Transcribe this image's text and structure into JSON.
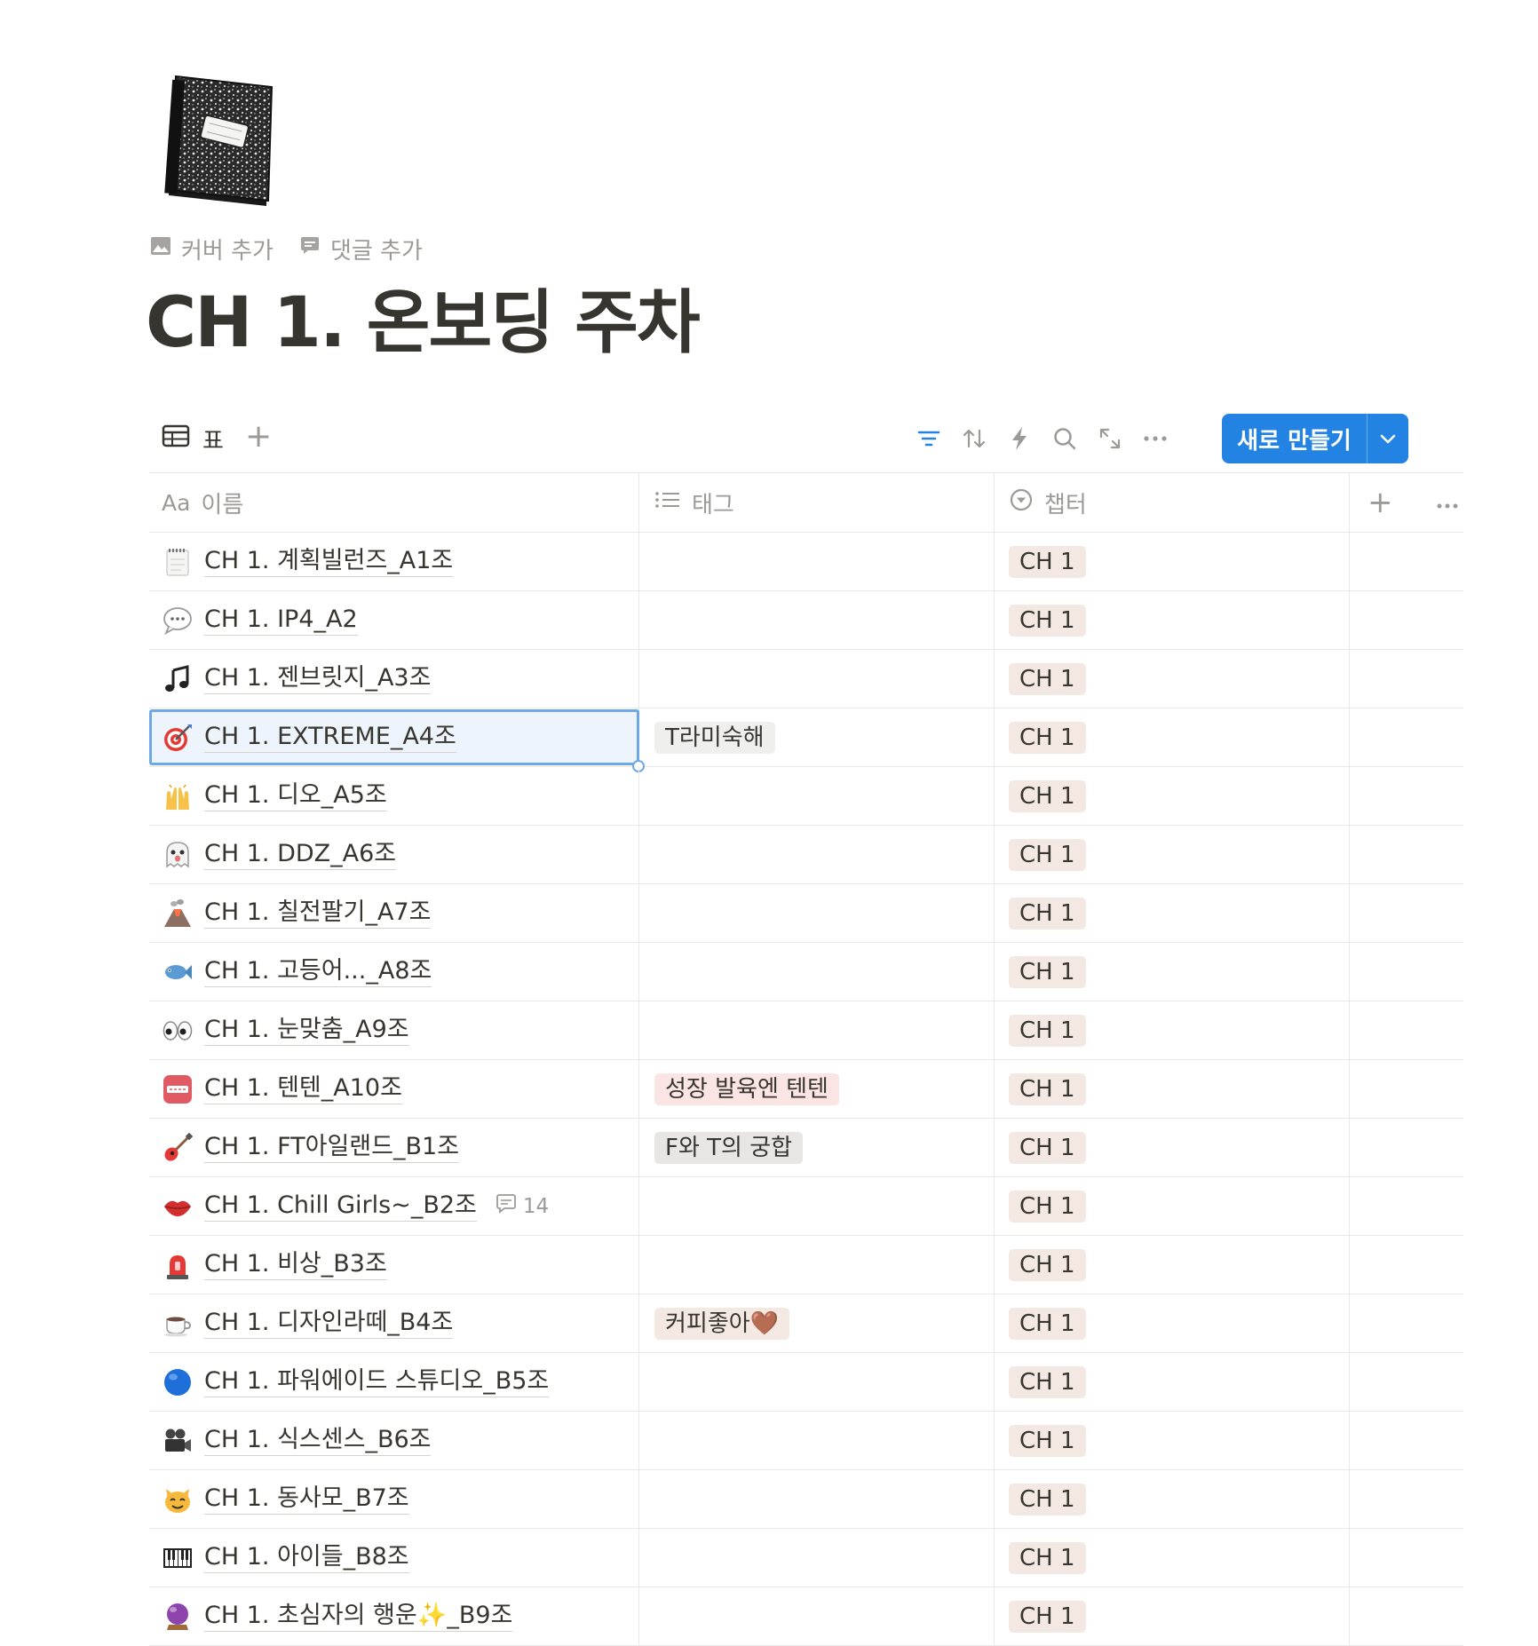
{
  "page": {
    "icon": "notebook-icon",
    "actions": {
      "cover_label": "커버 추가",
      "comment_label": "댓글 추가"
    },
    "title": "CH 1. 온보딩 주차"
  },
  "toolbar": {
    "view_label": "표",
    "new_label": "새로 만들기",
    "tools": [
      "filter-icon",
      "sort-icon",
      "automation-icon",
      "search-icon",
      "expand-icon",
      "more-icon"
    ],
    "accent": "#2383e2"
  },
  "table": {
    "headers": {
      "name_prefix": "Aa",
      "name": "이름",
      "tag": "태그",
      "chapter": "챕터"
    },
    "rows": [
      {
        "icon": "notepad-icon",
        "name": "CH 1. 계획빌런즈_A1조",
        "tag": "",
        "chapter": "CH 1"
      },
      {
        "icon": "speech-bubble-icon",
        "name": "CH 1. IP4_A2",
        "tag": "",
        "chapter": "CH 1"
      },
      {
        "icon": "music-note-icon",
        "name": "CH 1. 젠브릿지_A3조",
        "tag": "",
        "chapter": "CH 1"
      },
      {
        "icon": "dart-target-icon",
        "name": "CH 1. EXTREME_A4조",
        "tag": "T라미숙해",
        "chapter": "CH 1"
      },
      {
        "icon": "raised-hands-icon",
        "name": "CH 1. 디오_A5조",
        "tag": "",
        "chapter": "CH 1"
      },
      {
        "icon": "ghost-icon",
        "name": "CH 1. DDZ_A6조",
        "tag": "",
        "chapter": "CH 1"
      },
      {
        "icon": "volcano-icon",
        "name": "CH 1. 칠전팔기_A7조",
        "tag": "",
        "chapter": "CH 1"
      },
      {
        "icon": "fish-icon",
        "name": "CH 1. 고등어..._A8조",
        "tag": "",
        "chapter": "CH 1"
      },
      {
        "icon": "eyes-icon",
        "name": "CH 1. 눈맞춤_A9조",
        "tag": "",
        "chapter": "CH 1"
      },
      {
        "icon": "tenten-logo-icon",
        "name": "CH 1. 텐텐_A10조",
        "tag": "성장 발육엔 텐텐",
        "chapter": "CH 1"
      },
      {
        "icon": "guitar-icon",
        "name": "CH 1. FT아일랜드_B1조",
        "tag": "F와 T의 궁합",
        "chapter": "CH 1"
      },
      {
        "icon": "lips-icon",
        "name": "CH 1. Chill Girls~_B2조",
        "tag": "",
        "chapter": "CH 1",
        "comments": "14"
      },
      {
        "icon": "siren-icon",
        "name": "CH 1. 비상_B3조",
        "tag": "",
        "chapter": "CH 1"
      },
      {
        "icon": "coffee-icon",
        "name": "CH 1. 디자인라떼_B4조",
        "tag": "커피좋아🤎",
        "chapter": "CH 1"
      },
      {
        "icon": "blue-circle-icon",
        "name": "CH 1. 파워에이드 스튜디오_B5조",
        "tag": "",
        "chapter": "CH 1"
      },
      {
        "icon": "movie-camera-icon",
        "name": "CH 1. 식스센스_B6조",
        "tag": "",
        "chapter": "CH 1"
      },
      {
        "icon": "cat-face-icon",
        "name": "CH 1. 동사모_B7조",
        "tag": "",
        "chapter": "CH 1"
      },
      {
        "icon": "piano-keys-icon",
        "name": "CH 1. 아이들_B8조",
        "tag": "",
        "chapter": "CH 1"
      },
      {
        "icon": "crystal-ball-icon",
        "name": "CH 1. 초심자의 행운✨_B9조",
        "tag": "",
        "chapter": "CH 1"
      }
    ],
    "tag_colors": {
      "T라미숙해": "#efefed",
      "성장 발육엔 텐텐": "#fbe4e4",
      "F와 T의 궁합": "#e7e6e3",
      "커피좋아🤎": "#f4e9e2"
    },
    "selected_row": 3
  }
}
